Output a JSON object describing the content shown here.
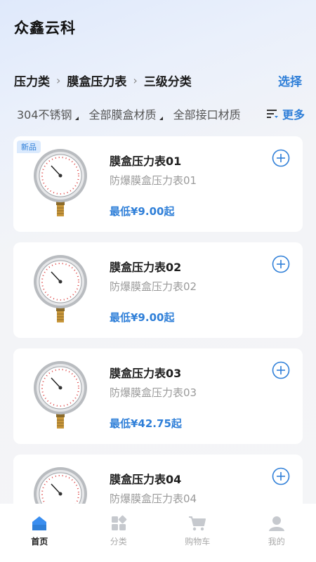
{
  "app": {
    "title": "众鑫云科"
  },
  "breadcrumb": {
    "items": [
      "压力类",
      "膜盒压力表",
      "三级分类"
    ],
    "select_label": "选择"
  },
  "filters": {
    "items": [
      "304不锈钢",
      "全部膜盒材质",
      "全部接口材质"
    ],
    "more_label": "更多"
  },
  "products": [
    {
      "badge": "新品",
      "name": "膜盒压力表01",
      "subtitle": "防爆膜盒压力表01",
      "price": "最低¥9.00起"
    },
    {
      "badge": "",
      "name": "膜盒压力表02",
      "subtitle": "防爆膜盒压力表02",
      "price": "最低¥9.00起"
    },
    {
      "badge": "",
      "name": "膜盒压力表03",
      "subtitle": "防爆膜盒压力表03",
      "price": "最低¥42.75起"
    },
    {
      "badge": "",
      "name": "膜盒压力表04",
      "subtitle": "防爆膜盒压力表04",
      "price": ""
    }
  ],
  "tabbar": {
    "items": [
      {
        "label": "首页",
        "icon": "home-icon",
        "active": true
      },
      {
        "label": "分类",
        "icon": "category-icon",
        "active": false
      },
      {
        "label": "购物车",
        "icon": "cart-icon",
        "active": false
      },
      {
        "label": "我的",
        "icon": "profile-icon",
        "active": false
      }
    ]
  },
  "colors": {
    "accent": "#2f7fd8",
    "badge_bg": "#dbeafd"
  }
}
